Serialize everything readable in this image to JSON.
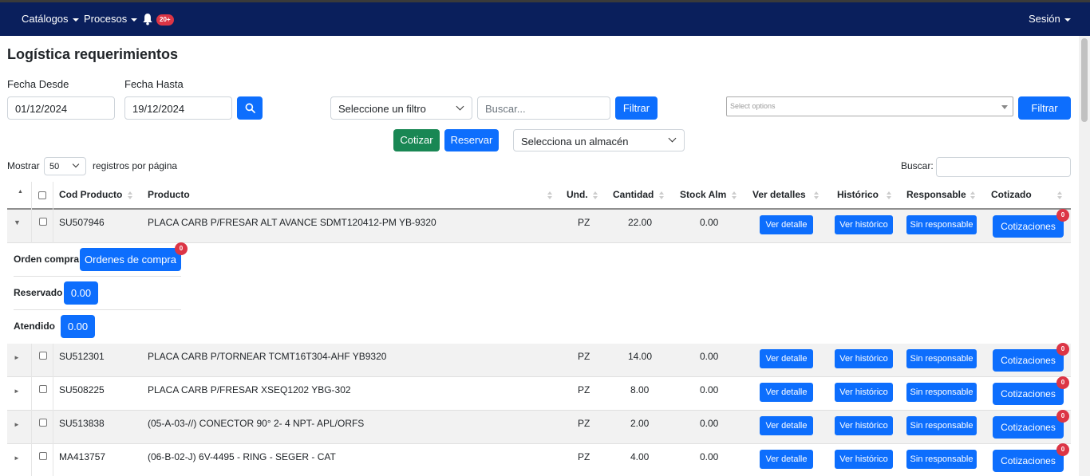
{
  "nav": {
    "catalogos": "Catálogos",
    "procesos": "Procesos",
    "notif_count": "20+",
    "sesion": "Sesión"
  },
  "page": {
    "title": "Logística requerimientos"
  },
  "filters": {
    "fecha_desde_label": "Fecha Desde",
    "fecha_desde_value": "01/12/2024",
    "fecha_hasta_label": "Fecha Hasta",
    "fecha_hasta_value": "19/12/2024",
    "filter_select": "Seleccione un filtro",
    "search_placeholder": "Buscar...",
    "filtrar_label": "Filtrar",
    "multiselect_placeholder": "Select options",
    "filtrar2_label": "Filtrar"
  },
  "actions": {
    "cotizar": "Cotizar",
    "reservar": "Reservar",
    "almacen_select": "Selecciona un almacén"
  },
  "table_controls": {
    "mostrar": "Mostrar",
    "page_size": "50",
    "registros": "registros por página",
    "buscar_label": "Buscar:"
  },
  "table": {
    "headers": {
      "cod": "Cod Producto",
      "producto": "Producto",
      "und": "Und.",
      "cantidad": "Cantidad",
      "stock": "Stock Alm",
      "detalles": "Ver detalles",
      "historico": "Histórico",
      "responsable": "Responsable",
      "cotizado": "Cotizado"
    },
    "rows": [
      {
        "cod": "SU507946",
        "producto": "PLACA CARB P/FRESAR ALT AVANCE SDMT120412-PM YB-9320",
        "und": "PZ",
        "cantidad": "22.00",
        "stock": "0.00",
        "detalle": "Ver detalle",
        "historico": "Ver histórico",
        "responsable": "Sin responsable",
        "cotizaciones": "Cotizaciones",
        "badge": "0",
        "expanded": true
      },
      {
        "cod": "SU512301",
        "producto": "PLACA CARB P/TORNEAR TCMT16T304-AHF YB9320",
        "und": "PZ",
        "cantidad": "14.00",
        "stock": "0.00",
        "detalle": "Ver detalle",
        "historico": "Ver histórico",
        "responsable": "Sin responsable",
        "cotizaciones": "Cotizaciones",
        "badge": "0"
      },
      {
        "cod": "SU508225",
        "producto": "PLACA CARB P/FRESAR XSEQ1202 YBG-302",
        "und": "PZ",
        "cantidad": "8.00",
        "stock": "0.00",
        "detalle": "Ver detalle",
        "historico": "Ver histórico",
        "responsable": "Sin responsable",
        "cotizaciones": "Cotizaciones",
        "badge": "0"
      },
      {
        "cod": "SU513838",
        "producto": "(05-A-03-//) CONECTOR 90° 2- 4 NPT- APL/ORFS",
        "und": "PZ",
        "cantidad": "2.00",
        "stock": "0.00",
        "detalle": "Ver detalle",
        "historico": "Ver histórico",
        "responsable": "Sin responsable",
        "cotizaciones": "Cotizaciones",
        "badge": "0"
      },
      {
        "cod": "MA413757",
        "producto": "(06-B-02-J) 6V-4495 - RING - SEGER - CAT",
        "und": "PZ",
        "cantidad": "4.00",
        "stock": "0.00",
        "detalle": "Ver detalle",
        "historico": "Ver histórico",
        "responsable": "Sin responsable",
        "cotizaciones": "Cotizaciones",
        "badge": "0"
      }
    ]
  },
  "details": {
    "orden_compra_label": "Orden compra",
    "ordenes_button": "Ordenes de compra",
    "ordenes_badge": "0",
    "reservado_label": "Reservado",
    "reservado_value": "0.00",
    "atendido_label": "Atendido",
    "atendido_value": "0.00"
  }
}
